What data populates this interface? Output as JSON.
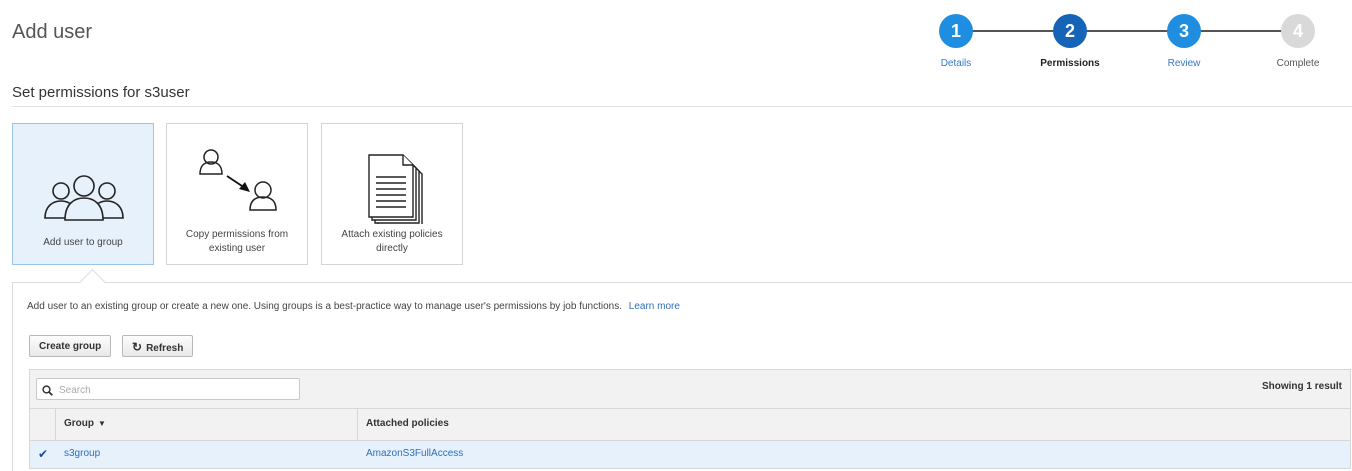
{
  "page": {
    "title": "Add user"
  },
  "stepper": {
    "steps": [
      {
        "number": "1",
        "label": "Details",
        "state": "done"
      },
      {
        "number": "2",
        "label": "Permissions",
        "state": "current"
      },
      {
        "number": "3",
        "label": "Review",
        "state": "done"
      },
      {
        "number": "4",
        "label": "Complete",
        "state": "pending"
      }
    ]
  },
  "permissions": {
    "title": "Set permissions for s3user",
    "options": [
      {
        "label": "Add user to group",
        "icon": "users-group-icon",
        "selected": true
      },
      {
        "label": "Copy permissions from existing user",
        "icon": "copy-user-icon",
        "selected": false
      },
      {
        "label": "Attach existing policies directly",
        "icon": "document-icon",
        "selected": false
      }
    ]
  },
  "panel": {
    "description": "Add user to an existing group or create a new one. Using groups is a best-practice way to manage user's permissions by job functions.",
    "learn_more": "Learn more",
    "create_group_label": "Create group",
    "refresh_label": "Refresh",
    "refresh_icon": "refresh-icon",
    "search_placeholder": "Search",
    "search_icon": "search-icon",
    "result_count": "Showing 1 result"
  },
  "table": {
    "columns": [
      "Group",
      "Attached policies"
    ],
    "rows": [
      {
        "checked": true,
        "group": "s3group",
        "policies": "AmazonS3FullAccess"
      }
    ]
  },
  "colors": {
    "accent": "#1f8ee0",
    "current_step": "#1564b8",
    "selected_bg": "#e6f1fc",
    "link": "#2e6fbd"
  }
}
